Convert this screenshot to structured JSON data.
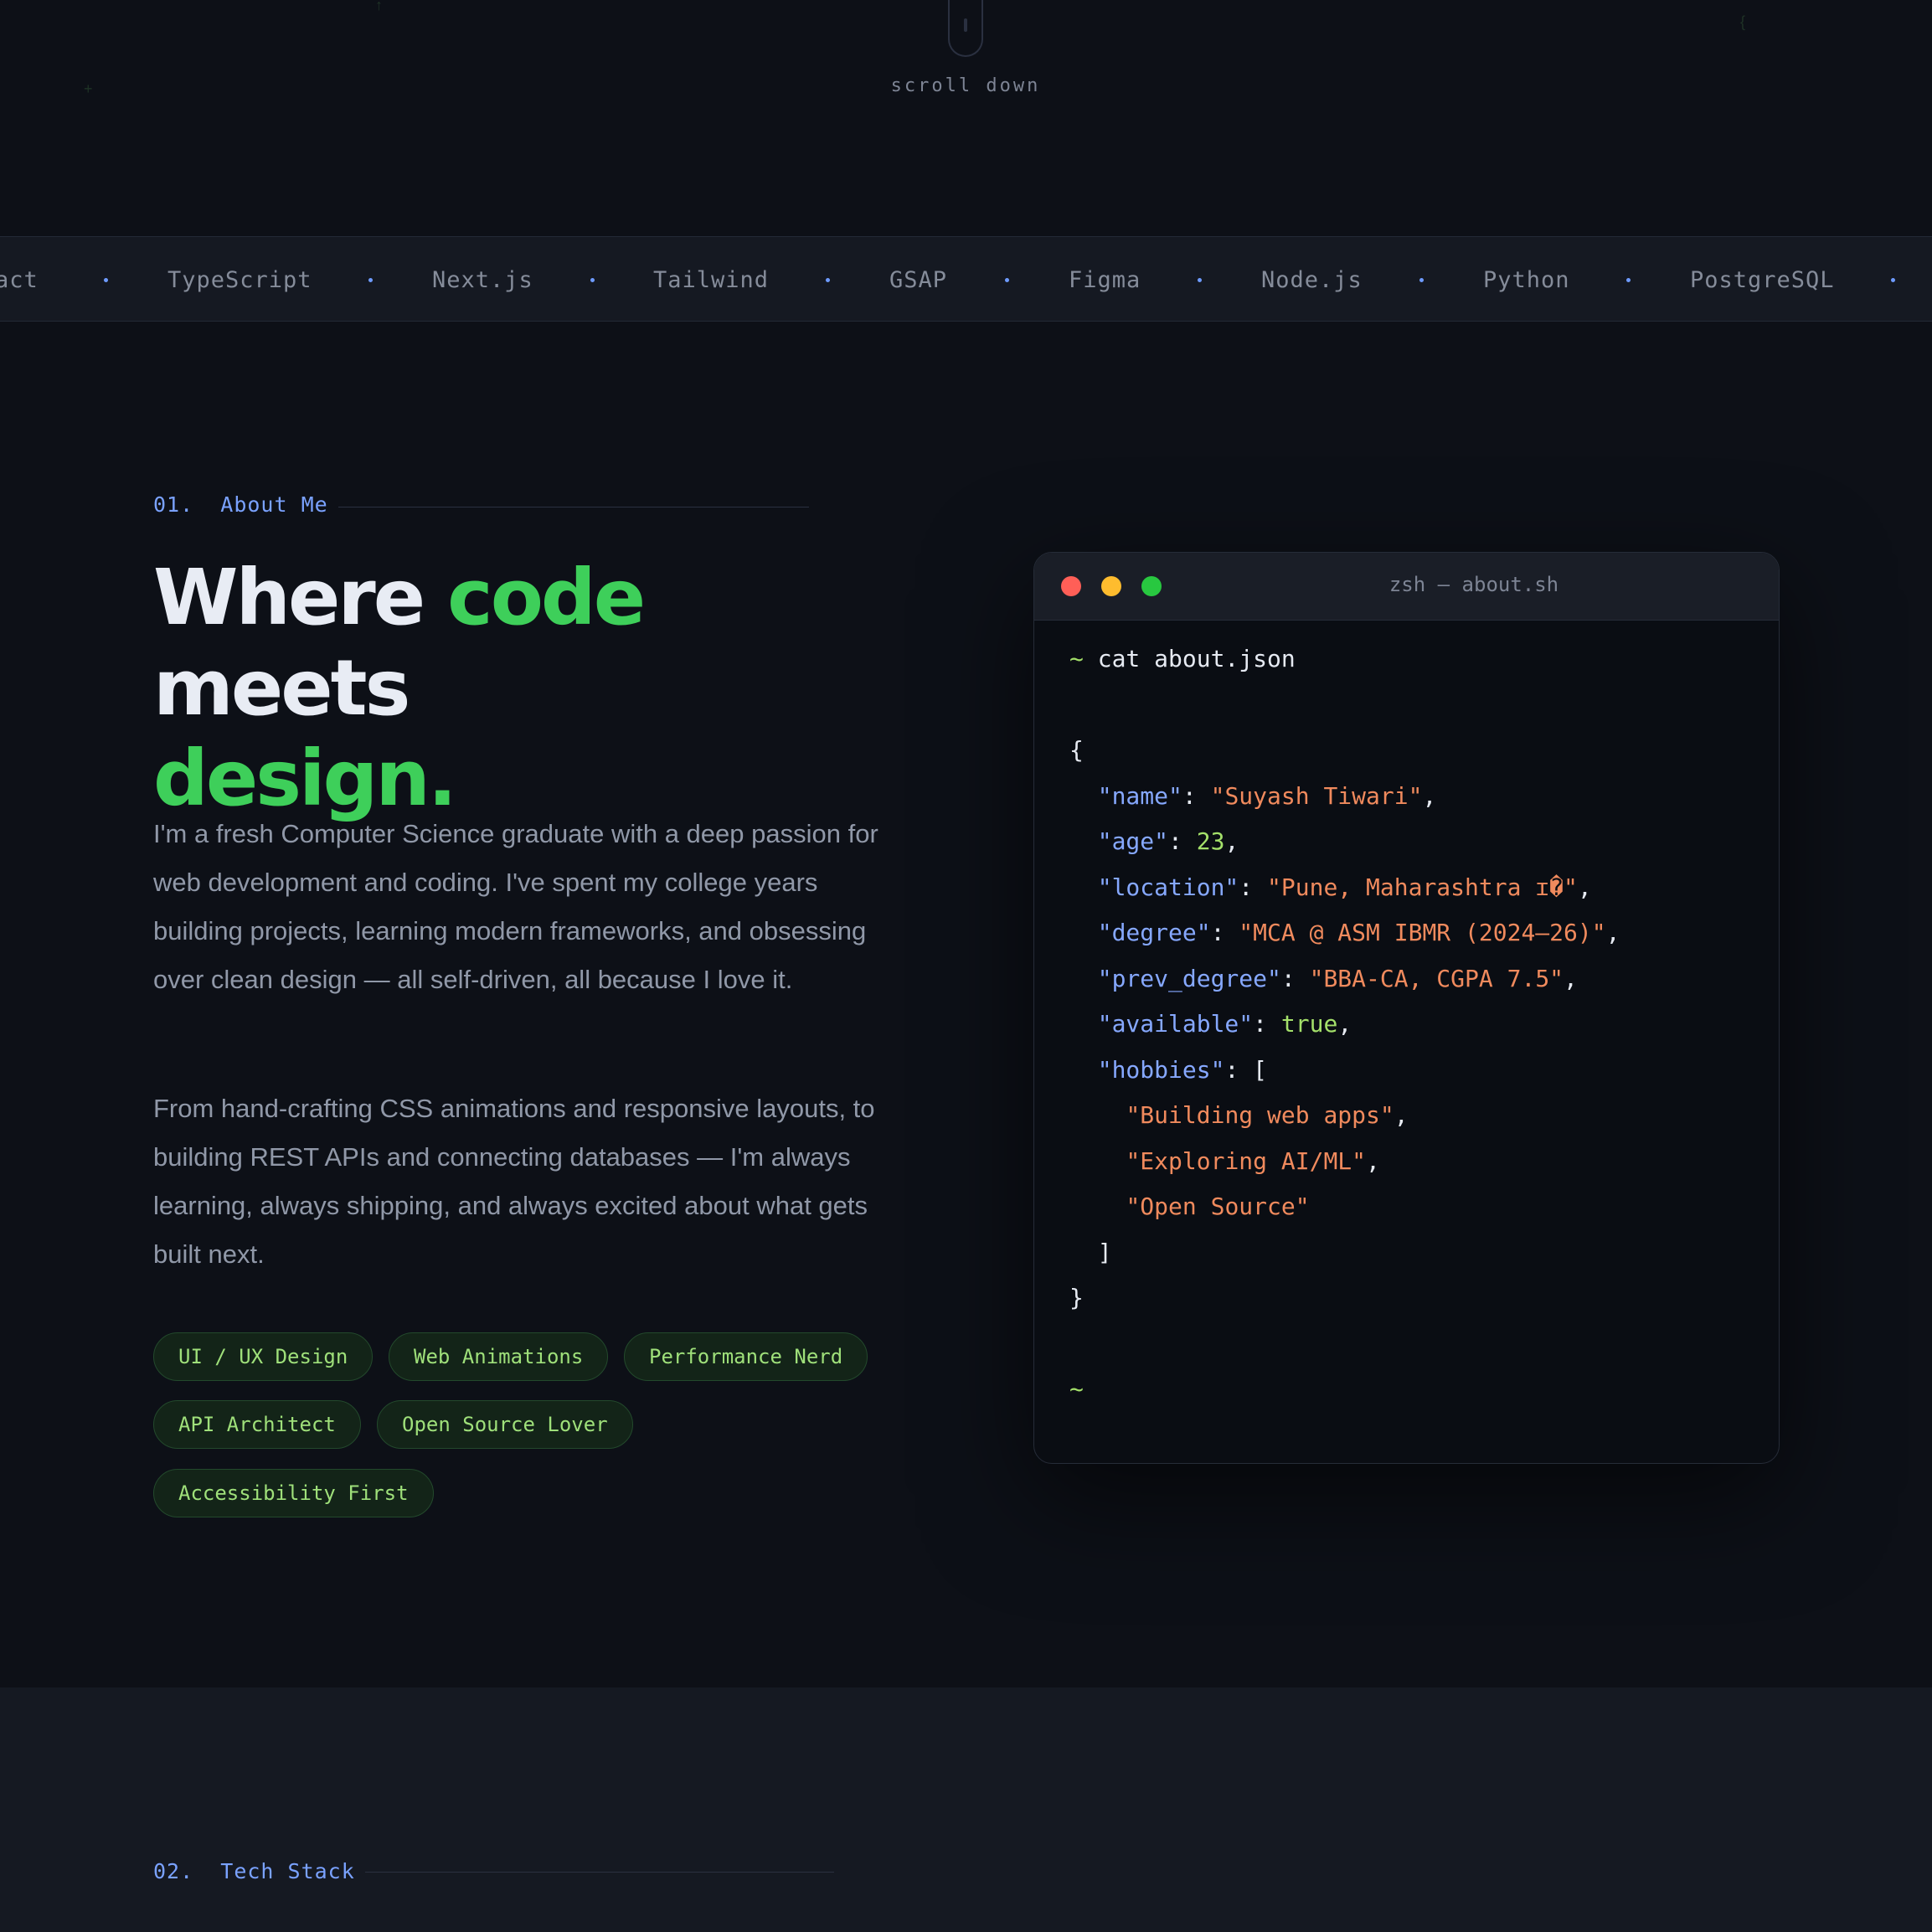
{
  "hero": {
    "scroll_label": "scroll down"
  },
  "marquee": {
    "items": [
      "act",
      "TypeScript",
      "Next.js",
      "Tailwind",
      "GSAP",
      "Figma",
      "Node.js",
      "Python",
      "PostgreSQL"
    ]
  },
  "about": {
    "number": "01.",
    "label": "About Me",
    "headline": {
      "part1": "Where ",
      "highlight1": "code",
      "part2": " meets",
      "highlight2": "design."
    },
    "paragraphs": [
      "I'm a fresh Computer Science graduate with a deep passion for web development and coding. I've spent my college years building projects, learning modern frameworks, and obsessing over clean design — all self-driven, all because I love it.",
      "From hand-crafting CSS animations and responsive layouts, to building REST APIs and connecting databases — I'm always learning, always shipping, and always excited about what gets built next."
    ],
    "tags": [
      "UI / UX Design",
      "Web Animations",
      "Performance Nerd",
      "API Architect",
      "Open Source Lover",
      "Accessibility First"
    ]
  },
  "terminal": {
    "title": "zsh — about.sh",
    "prompt": "~",
    "command": "cat about.json",
    "open_brace": "{",
    "close_brace": "}",
    "fields": {
      "name_key": "\"name\"",
      "name_val": "\"Suyash Tiwari\"",
      "age_key": "\"age\"",
      "age_val": "23",
      "location_key": "\"location\"",
      "location_val": "\"Pune, Maharashtra ɪ�\"",
      "degree_key": "\"degree\"",
      "degree_val": "\"MCA @ ASM IBMR (2024–26)\"",
      "prev_degree_key": "\"prev_degree\"",
      "prev_degree_val": "\"BBA-CA, CGPA 7.5\"",
      "available_key": "\"available\"",
      "available_val": "true",
      "hobbies_key": "\"hobbies\"",
      "hobbies": [
        "\"Building web apps\"",
        "\"Exploring AI/ML\"",
        "\"Open Source\""
      ]
    },
    "traffic_lights": [
      "#ff5f57",
      "#febc2e",
      "#28c840"
    ]
  },
  "tech_stack": {
    "number": "02.",
    "label": "Tech Stack"
  },
  "colors": {
    "accent_blue": "#7aa2ff",
    "accent_green": "#3ecf5a",
    "string_orange": "#f08a5d",
    "background": "#0d1017"
  }
}
